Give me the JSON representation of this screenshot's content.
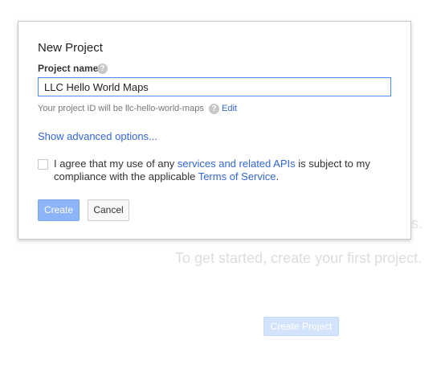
{
  "background": {
    "partial_text": "s.",
    "subtitle": "To get started, create your first project.",
    "create_button_label": "Create Project"
  },
  "dialog": {
    "title": "New Project",
    "project_name_label": "Project name",
    "help_icon_glyph": "?",
    "project_name_value": "LLC Hello World Maps",
    "project_id_text": "Your project ID will be llc-hello-world-maps",
    "edit_label": "Edit",
    "advanced_link": "Show advanced options...",
    "agreement": {
      "checked": false,
      "text_before": "I agree that my use of any ",
      "link1": "services and related APIs",
      "text_middle": " is subject to my compliance with the applicable ",
      "link2": "Terms of Service",
      "text_after": "."
    },
    "create_label": "Create",
    "cancel_label": "Cancel"
  },
  "colors": {
    "link": "#3367d6",
    "primary_disabled": "#8db4f8",
    "input_focus_border": "#4d90fe"
  },
  "icons": {
    "help": "help-icon"
  }
}
